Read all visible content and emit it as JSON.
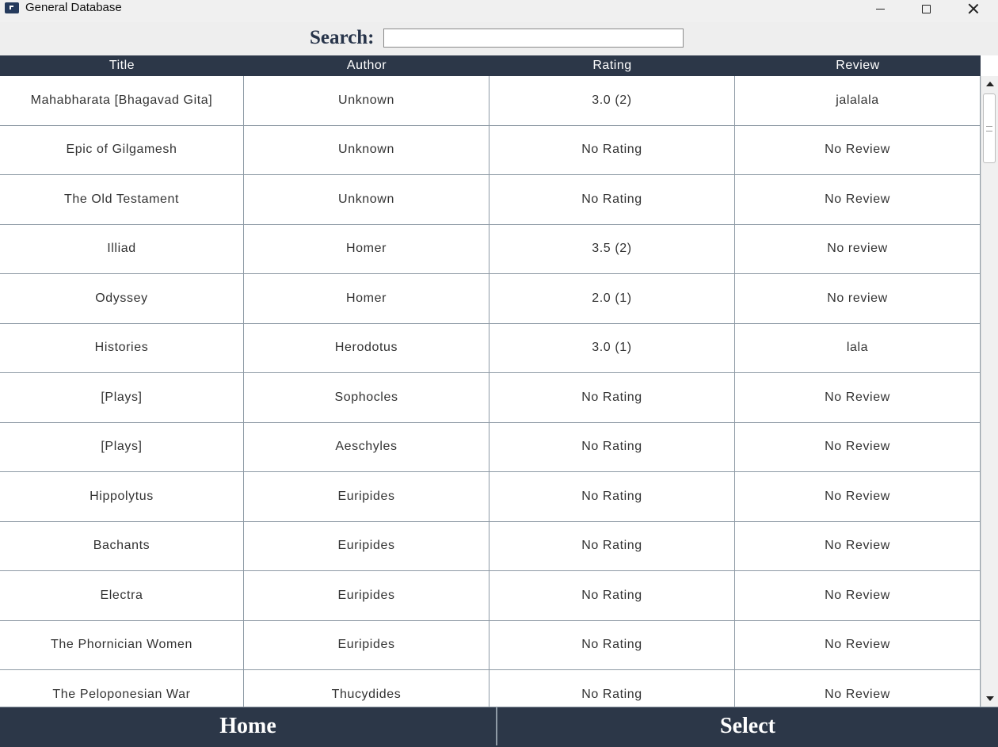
{
  "window": {
    "title": "General Database",
    "app_icon": "database-icon"
  },
  "search": {
    "label": "Search:",
    "value": "",
    "placeholder": ""
  },
  "table": {
    "columns": [
      "Title",
      "Author",
      "Rating",
      "Review"
    ],
    "rows": [
      [
        "Mahabharata [Bhagavad Gita]",
        "Unknown",
        "3.0 (2)",
        "jalalala"
      ],
      [
        "Epic of Gilgamesh",
        "Unknown",
        "No Rating",
        "No Review"
      ],
      [
        "The Old Testament",
        "Unknown",
        "No Rating",
        "No Review"
      ],
      [
        "Illiad",
        "Homer",
        "3.5 (2)",
        "No review"
      ],
      [
        "Odyssey",
        "Homer",
        "2.0 (1)",
        "No review"
      ],
      [
        "Histories",
        "Herodotus",
        "3.0 (1)",
        "lala"
      ],
      [
        "[Plays]",
        "Sophocles",
        "No Rating",
        "No Review"
      ],
      [
        "[Plays]",
        "Aeschyles",
        "No Rating",
        "No Review"
      ],
      [
        "Hippolytus",
        "Euripides",
        "No Rating",
        "No Review"
      ],
      [
        "Bachants",
        "Euripides",
        "No Rating",
        "No Review"
      ],
      [
        "Electra",
        "Euripides",
        "No Rating",
        "No Review"
      ],
      [
        "The Phornician Women",
        "Euripides",
        "No Rating",
        "No Review"
      ],
      [
        "The Peloponesian War",
        "Thucydides",
        "No Rating",
        "No Review"
      ]
    ]
  },
  "buttons": {
    "home": "Home",
    "select": "Select"
  },
  "colors": {
    "header_bg": "#2c3748",
    "grid_line": "#8e9aa5",
    "search_label": "#27344a"
  }
}
